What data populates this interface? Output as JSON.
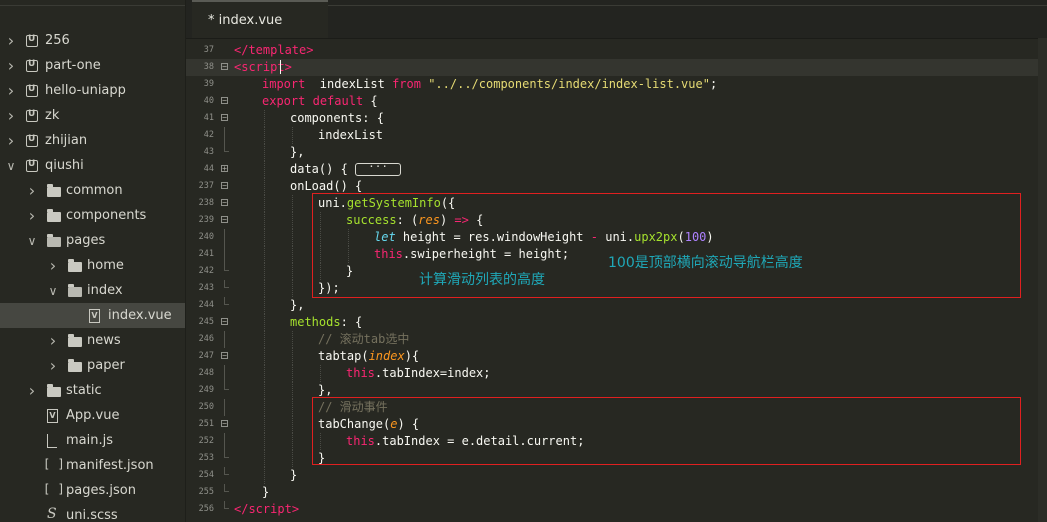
{
  "sidebar": {
    "items": [
      {
        "label": "256",
        "icon": "project-icon",
        "expand": "collapsed"
      },
      {
        "label": "part-one",
        "icon": "project-icon",
        "expand": "collapsed"
      },
      {
        "label": "hello-uniapp",
        "icon": "project-icon",
        "expand": "collapsed"
      },
      {
        "label": "zk",
        "icon": "project-icon",
        "expand": "collapsed"
      },
      {
        "label": "zhijian",
        "icon": "project-icon",
        "expand": "collapsed"
      },
      {
        "label": "qiushi",
        "icon": "project-icon",
        "expand": "expanded"
      },
      {
        "label": "common",
        "icon": "folder-icon",
        "expand": "collapsed"
      },
      {
        "label": "components",
        "icon": "folder-icon",
        "expand": "collapsed"
      },
      {
        "label": "pages",
        "icon": "folder-open-icon",
        "expand": "expanded"
      },
      {
        "label": "home",
        "icon": "folder-icon",
        "expand": "collapsed"
      },
      {
        "label": "index",
        "icon": "folder-open-icon",
        "expand": "expanded"
      },
      {
        "label": "index.vue",
        "icon": "vue-file-icon",
        "expand": "none",
        "selected": true
      },
      {
        "label": "news",
        "icon": "folder-icon",
        "expand": "collapsed"
      },
      {
        "label": "paper",
        "icon": "folder-icon",
        "expand": "collapsed"
      },
      {
        "label": "static",
        "icon": "folder-icon",
        "expand": "collapsed"
      },
      {
        "label": "App.vue",
        "icon": "vue-file-icon",
        "expand": "none"
      },
      {
        "label": "main.js",
        "icon": "js-file-icon",
        "expand": "none"
      },
      {
        "label": "manifest.json",
        "icon": "json-file-icon",
        "expand": "none"
      },
      {
        "label": "pages.json",
        "icon": "json-file-icon",
        "expand": "none"
      },
      {
        "label": "uni.scss",
        "icon": "scss-file-icon",
        "expand": "none"
      }
    ]
  },
  "editor": {
    "tab_label": "* index.vue",
    "lines": [
      {
        "n": "37",
        "tokens": [
          [
            "tag",
            "</"
          ],
          [
            "tag",
            "template"
          ],
          [
            "tag",
            ">"
          ]
        ]
      },
      {
        "n": "38",
        "tokens": [
          [
            "tag",
            "<"
          ],
          [
            "tag",
            "script"
          ],
          [
            "tag",
            ">"
          ]
        ]
      },
      {
        "n": "39",
        "tokens": [
          [
            "kw",
            "import"
          ],
          [
            "",
            "  indexList "
          ],
          [
            "kw",
            "from"
          ],
          [
            "",
            ""
          ],
          [
            "str",
            " \"../../components/index/index-list.vue\""
          ],
          [
            "",
            ";"
          ]
        ]
      },
      {
        "n": "40",
        "tokens": [
          [
            "kw",
            "export"
          ],
          [
            "",
            " "
          ],
          [
            "kw",
            "default"
          ],
          [
            "",
            " {"
          ]
        ]
      },
      {
        "n": "41",
        "tokens": [
          [
            "",
            "components: {"
          ]
        ]
      },
      {
        "n": "42",
        "tokens": [
          [
            "",
            "indexList"
          ]
        ]
      },
      {
        "n": "43",
        "tokens": [
          [
            "",
            "},"
          ]
        ]
      },
      {
        "n": "44",
        "tokens": [
          [
            "",
            "data() { "
          ],
          [
            "pill",
            "···"
          ]
        ]
      },
      {
        "n": "237",
        "tokens": [
          [
            "",
            "onLoad() {"
          ]
        ]
      },
      {
        "n": "238",
        "tokens": [
          [
            "",
            "uni."
          ],
          [
            "fn",
            "getSystemInfo"
          ],
          [
            "",
            "({"
          ]
        ]
      },
      {
        "n": "239",
        "tokens": [
          [
            "fn",
            "success"
          ],
          [
            "",
            ": ("
          ],
          [
            "prm",
            "res"
          ],
          [
            "",
            ") "
          ],
          [
            "kw",
            "=>"
          ],
          [
            "",
            " {"
          ]
        ]
      },
      {
        "n": "240",
        "tokens": [
          [
            "it",
            "let"
          ],
          [
            "",
            " height = res.windowHeight "
          ],
          [
            "kw",
            "-"
          ],
          [
            "",
            " uni."
          ],
          [
            "fn",
            "upx2px"
          ],
          [
            "",
            "("
          ],
          [
            "num",
            "100"
          ],
          [
            "",
            ")"
          ]
        ]
      },
      {
        "n": "241",
        "tokens": [
          [
            "kw",
            "this"
          ],
          [
            "",
            ".swiperheight = height;"
          ]
        ]
      },
      {
        "n": "242",
        "tokens": [
          [
            "",
            "}"
          ]
        ]
      },
      {
        "n": "243",
        "tokens": [
          [
            "",
            "});"
          ]
        ]
      },
      {
        "n": "244",
        "tokens": [
          [
            "",
            "},"
          ]
        ]
      },
      {
        "n": "245",
        "tokens": [
          [
            "fn",
            "methods"
          ],
          [
            "",
            ": {"
          ]
        ]
      },
      {
        "n": "246",
        "tokens": [
          [
            "cm",
            "// 滚动tab选中"
          ]
        ]
      },
      {
        "n": "247",
        "tokens": [
          [
            "",
            "tabtap("
          ],
          [
            "prm",
            "index"
          ],
          [
            "",
            "){"
          ]
        ]
      },
      {
        "n": "248",
        "tokens": [
          [
            "kw",
            "this"
          ],
          [
            "",
            ".tabIndex=index;"
          ]
        ]
      },
      {
        "n": "249",
        "tokens": [
          [
            "",
            "},"
          ]
        ]
      },
      {
        "n": "250",
        "tokens": [
          [
            "cm",
            "// 滑动事件"
          ]
        ]
      },
      {
        "n": "251",
        "tokens": [
          [
            "",
            "tabChange("
          ],
          [
            "prm",
            "e"
          ],
          [
            "",
            ") {"
          ]
        ]
      },
      {
        "n": "252",
        "tokens": [
          [
            "kw",
            "this"
          ],
          [
            "",
            ".tabIndex = e.detail.current;"
          ]
        ]
      },
      {
        "n": "253",
        "tokens": [
          [
            "",
            "}"
          ]
        ]
      },
      {
        "n": "254",
        "tokens": [
          [
            "",
            "}"
          ]
        ]
      },
      {
        "n": "255",
        "tokens": [
          [
            "",
            "}"
          ]
        ]
      },
      {
        "n": "256",
        "tokens": [
          [
            "tag",
            "</"
          ],
          [
            "tag",
            "script"
          ],
          [
            "tag",
            ">"
          ]
        ]
      }
    ]
  },
  "annotations": {
    "note_1": "计算滑动列表的高度",
    "note_2": "100是顶部横向滚动导航栏高度"
  }
}
